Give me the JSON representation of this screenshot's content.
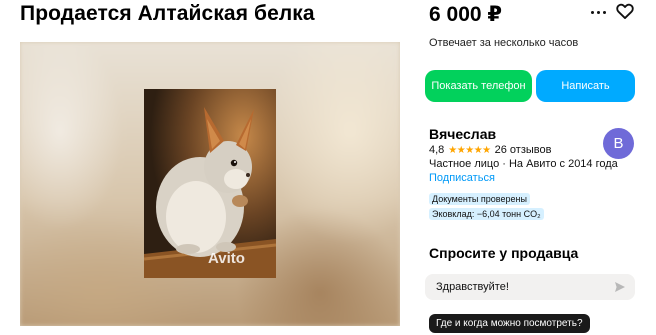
{
  "listing": {
    "title": "Продается Алтайская белка",
    "price": "6 000 ₽",
    "watermark": "Avito"
  },
  "seller_panel": {
    "reply_time": "Отвечает за несколько часов",
    "show_phone_label": "Показать телефон",
    "write_label": "Написать"
  },
  "seller": {
    "name": "Вячеслав",
    "rating": "4,8",
    "stars": "★★★★★",
    "reviews": "26 отзывов",
    "info": "Частное лицо · На Авито с 2014 года",
    "subscribe_label": "Подписаться",
    "avatar_letter": "В",
    "avatar_color": "#6f6ad8",
    "badges": {
      "docs": "Документы проверены",
      "eco": "Эковклад: −6,04 тонн CO₂"
    }
  },
  "ask": {
    "heading": "Спросите у продавца",
    "message_value": "Здравствуйте!",
    "quick_reply": "Где и когда можно посмотреть?"
  },
  "colors": {
    "phone_button": "#02d15c",
    "write_button": "#00aaff",
    "link": "#0099f7",
    "badge_bg": "#d6f0ff"
  }
}
